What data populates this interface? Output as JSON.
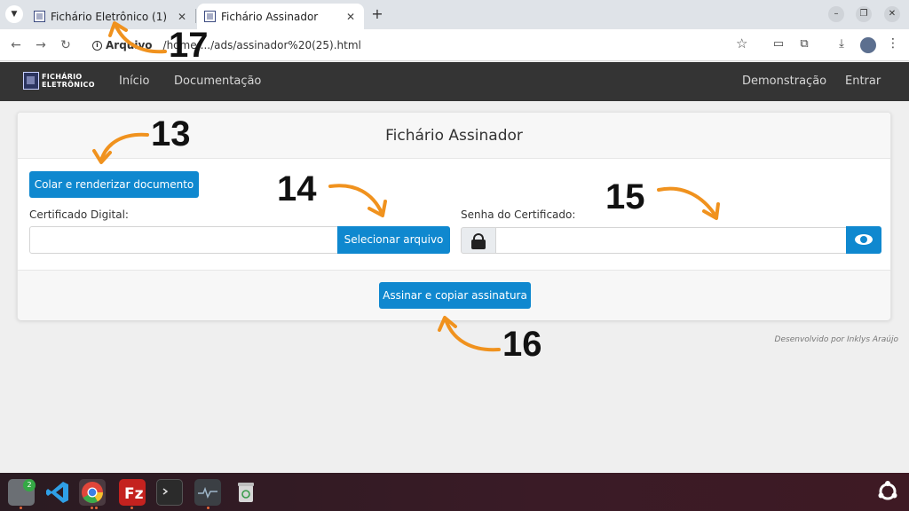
{
  "browser": {
    "tabs": [
      {
        "title": "Fichário Eletrônico (1)",
        "active": false
      },
      {
        "title": "Fichário Assinador",
        "active": true
      }
    ],
    "address": {
      "scheme_label": "Arquivo",
      "url": "/home/.../ads/assinador%20(25).html"
    }
  },
  "site": {
    "logo_line1": "FICHÁRIO",
    "logo_line2": "ELETRÔNICO",
    "nav_left": [
      "Início",
      "Documentação"
    ],
    "nav_right": [
      "Demonstração",
      "Entrar"
    ]
  },
  "card": {
    "title": "Fichário Assinador",
    "paste_button": "Colar e renderizar documento",
    "cert_label": "Certificado Digital:",
    "select_file_button": "Selecionar arquivo",
    "password_label": "Senha do Certificado:",
    "sign_button": "Assinar e copiar assinatura"
  },
  "credit": "Desenvolvido por Inklys Araújo",
  "annotations": [
    "13",
    "14",
    "15",
    "16",
    "17"
  ],
  "taskbar": {
    "files_badge": "2"
  },
  "colors": {
    "primary": "#0f88cf",
    "navbar": "#343434",
    "annotation_arrow": "#f0921e"
  }
}
